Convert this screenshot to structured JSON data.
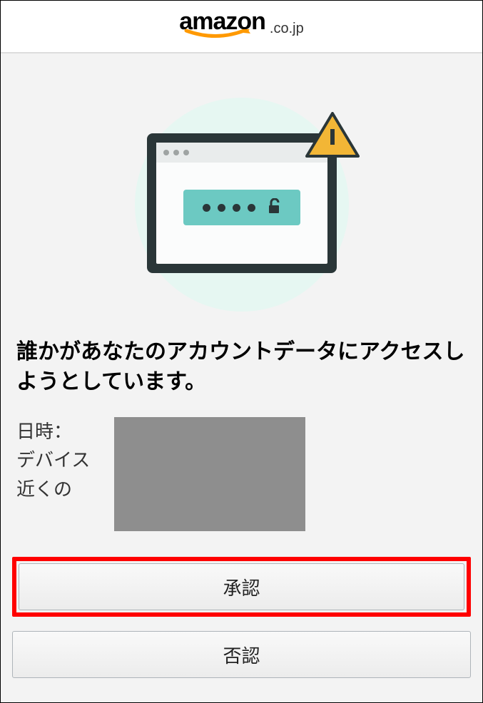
{
  "header": {
    "brand": "amazon",
    "tld": ".co.jp"
  },
  "alert": {
    "headline": "誰かがあなたのアカウントデータにアクセスしようとしています。",
    "labels": {
      "datetime": "日時：",
      "device": "デバイス",
      "near": "近くの"
    }
  },
  "buttons": {
    "approve": "承認",
    "deny": "否認"
  },
  "colors": {
    "highlight": "#ff0000",
    "brand_smile": "#ff9900",
    "warning": "#f2b636",
    "illustration_accent": "#6cc9c2",
    "illustration_bg": "#e6f7f2",
    "monitor": "#2a3638"
  },
  "icons": {
    "warning": "warning-triangle-icon",
    "lock": "unlocked-padlock-icon"
  }
}
